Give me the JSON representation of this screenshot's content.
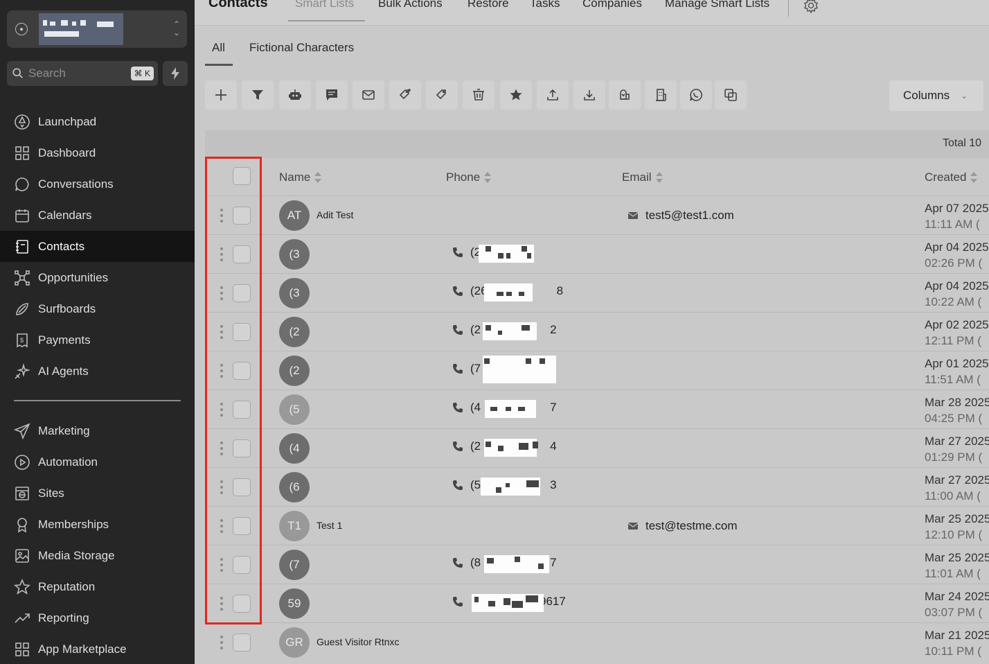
{
  "sidebar": {
    "account_icon": "user-circle-icon",
    "search": {
      "placeholder": "Search",
      "shortcut": "⌘ K"
    },
    "nav_primary": [
      {
        "label": "Launchpad",
        "icon": "rocket-icon"
      },
      {
        "label": "Dashboard",
        "icon": "grid-icon"
      },
      {
        "label": "Conversations",
        "icon": "chat-bubble-icon"
      },
      {
        "label": "Calendars",
        "icon": "calendar-icon"
      },
      {
        "label": "Contacts",
        "icon": "address-book-icon",
        "active": true
      },
      {
        "label": "Opportunities",
        "icon": "network-icon"
      },
      {
        "label": "Surfboards",
        "icon": "surfboard-icon"
      },
      {
        "label": "Payments",
        "icon": "receipt-icon"
      },
      {
        "label": "AI Agents",
        "icon": "sparkle-icon"
      }
    ],
    "nav_secondary": [
      {
        "label": "Marketing",
        "icon": "paper-plane-icon"
      },
      {
        "label": "Automation",
        "icon": "play-circle-icon"
      },
      {
        "label": "Sites",
        "icon": "globe-window-icon"
      },
      {
        "label": "Memberships",
        "icon": "badge-icon"
      },
      {
        "label": "Media Storage",
        "icon": "image-icon"
      },
      {
        "label": "Reputation",
        "icon": "star-icon"
      },
      {
        "label": "Reporting",
        "icon": "trend-icon"
      },
      {
        "label": "App Marketplace",
        "icon": "apps-icon"
      }
    ]
  },
  "header": {
    "title": "Contacts",
    "tabs": [
      "Smart Lists",
      "Bulk Actions",
      "Restore",
      "Tasks",
      "Companies",
      "Manage Smart Lists"
    ]
  },
  "subtabs": [
    "All",
    "Fictional Characters"
  ],
  "toolbar": {
    "buttons": [
      "plus-icon",
      "filter-icon",
      "robot-icon",
      "message-icon",
      "mail-icon",
      "tag-add-icon",
      "tag-remove-icon",
      "trash-icon",
      "star-icon",
      "upload-icon",
      "download-icon",
      "mailbox-icon",
      "building-icon",
      "whatsapp-icon",
      "copy-icon"
    ],
    "columns_label": "Columns"
  },
  "table": {
    "total_label": "Total 10",
    "headers": {
      "name": "Name",
      "phone": "Phone",
      "email": "Email",
      "created": "Created"
    },
    "rows": [
      {
        "initials": "AT",
        "name": "Adit Test",
        "phone": "",
        "email": "test5@test1.com",
        "date": "Apr 07 2025",
        "time": "11:11 AM ("
      },
      {
        "initials": "(3",
        "name": "",
        "phone": "(2",
        "phone_end": "",
        "email": "",
        "date": "Apr 04 2025",
        "time": "02:26 PM ("
      },
      {
        "initials": "(3",
        "name": "",
        "phone": "(26",
        "phone_end": "8",
        "email": "",
        "date": "Apr 04 2025",
        "time": "10:22 AM ("
      },
      {
        "initials": "(2",
        "name": "",
        "phone": "(2",
        "phone_end": "2",
        "email": "",
        "date": "Apr 02 2025",
        "time": "12:11 PM ("
      },
      {
        "initials": "(2",
        "name": "",
        "phone": "(7",
        "phone_end": "",
        "email": "",
        "date": "Apr 01 2025",
        "time": "11:51 AM ("
      },
      {
        "initials": "(5",
        "name": "",
        "phone": "(4",
        "phone_end": "7",
        "email": "",
        "date": "Mar 28 2025",
        "time": "04:25 PM ("
      },
      {
        "initials": "(4",
        "name": "",
        "phone": "(2",
        "phone_end": "4",
        "email": "",
        "date": "Mar 27 2025",
        "time": "01:29 PM ("
      },
      {
        "initials": "(6",
        "name": "",
        "phone": "(5",
        "phone_end": "3",
        "email": "",
        "date": "Mar 27 2025",
        "time": "11:00 AM ("
      },
      {
        "initials": "T1",
        "name": "Test 1",
        "phone": "",
        "email": "test@testme.com",
        "date": "Mar 25 2025",
        "time": "12:10 PM ("
      },
      {
        "initials": "(7",
        "name": "",
        "phone": "(8",
        "phone_end": "7",
        "email": "",
        "date": "Mar 25 2025",
        "time": "11:01 AM ("
      },
      {
        "initials": "59",
        "name": "",
        "phone": "",
        "phone_end": "9617",
        "email": "",
        "date": "Mar 24 2025",
        "time": "03:07 PM ("
      },
      {
        "initials": "GR",
        "name": "Guest Visitor Rtnxc",
        "phone": "",
        "email": "",
        "date": "Mar 21 2025",
        "time": "10:11 PM ("
      }
    ]
  },
  "colors": {
    "sidebar_bg": "#262626",
    "highlight": "#e3271f",
    "main_bg": "#c9c9c9"
  }
}
